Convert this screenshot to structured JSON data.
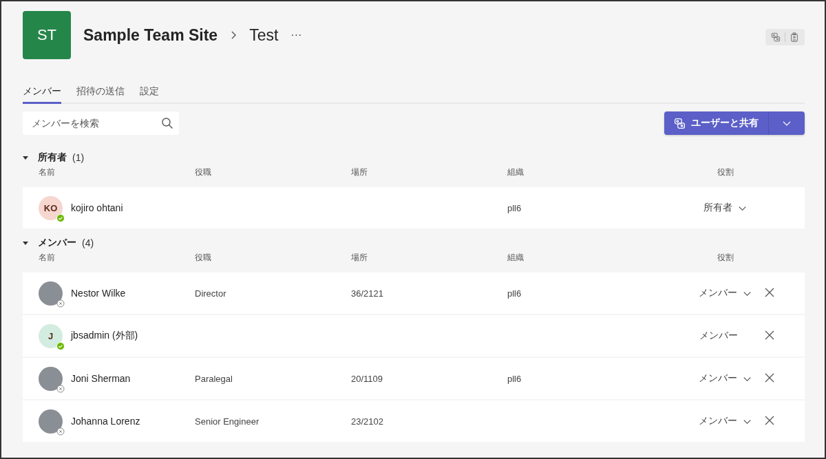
{
  "team": {
    "initials": "ST",
    "name": "Sample Team Site",
    "channel": "Test",
    "more": "···"
  },
  "tabs": [
    {
      "label": "メンバー",
      "selected": true
    },
    {
      "label": "招待の送信",
      "selected": false
    },
    {
      "label": "設定",
      "selected": false
    }
  ],
  "search": {
    "placeholder": "メンバーを検索"
  },
  "share_button": {
    "label": "ユーザーと共有"
  },
  "sections": [
    {
      "title": "所有者",
      "count": "(1)",
      "expanded": true,
      "columns": [
        "名前",
        "役職",
        "場所",
        "組織",
        "役割"
      ],
      "members": [
        {
          "avatar": {
            "kind": "initials",
            "text": "KO",
            "color": "#f6d6cf"
          },
          "available": true,
          "name": "kojiro ohtani",
          "org": "pll6",
          "role": "所有者",
          "role_editable": true,
          "removable": false
        }
      ]
    },
    {
      "title": "メンバー",
      "count": "(4)",
      "expanded": true,
      "columns": [
        "名前",
        "役職",
        "場所",
        "組織",
        "役割"
      ],
      "members": [
        {
          "avatar": {
            "kind": "photo"
          },
          "available": false,
          "name": "Nestor Wilke",
          "job_title": "Director",
          "location": "36/2121",
          "org": "pll6",
          "role": "メンバー",
          "role_editable": true,
          "removable": true
        },
        {
          "avatar": {
            "kind": "initials",
            "text": "J",
            "color": "#d3ece0"
          },
          "available": true,
          "name": "jbsadmin (外部)",
          "role": "メンバー",
          "role_editable": false,
          "removable": true
        },
        {
          "avatar": {
            "kind": "photo"
          },
          "available": false,
          "name": "Joni Sherman",
          "job_title": "Paralegal",
          "location": "20/1109",
          "org": "pll6",
          "role": "メンバー",
          "role_editable": true,
          "removable": true
        },
        {
          "avatar": {
            "kind": "photo"
          },
          "available": false,
          "name": "Johanna Lorenz",
          "job_title": "Senior Engineer",
          "location": "23/2102",
          "role": "メンバー",
          "role_editable": true,
          "removable": true
        }
      ]
    }
  ]
}
